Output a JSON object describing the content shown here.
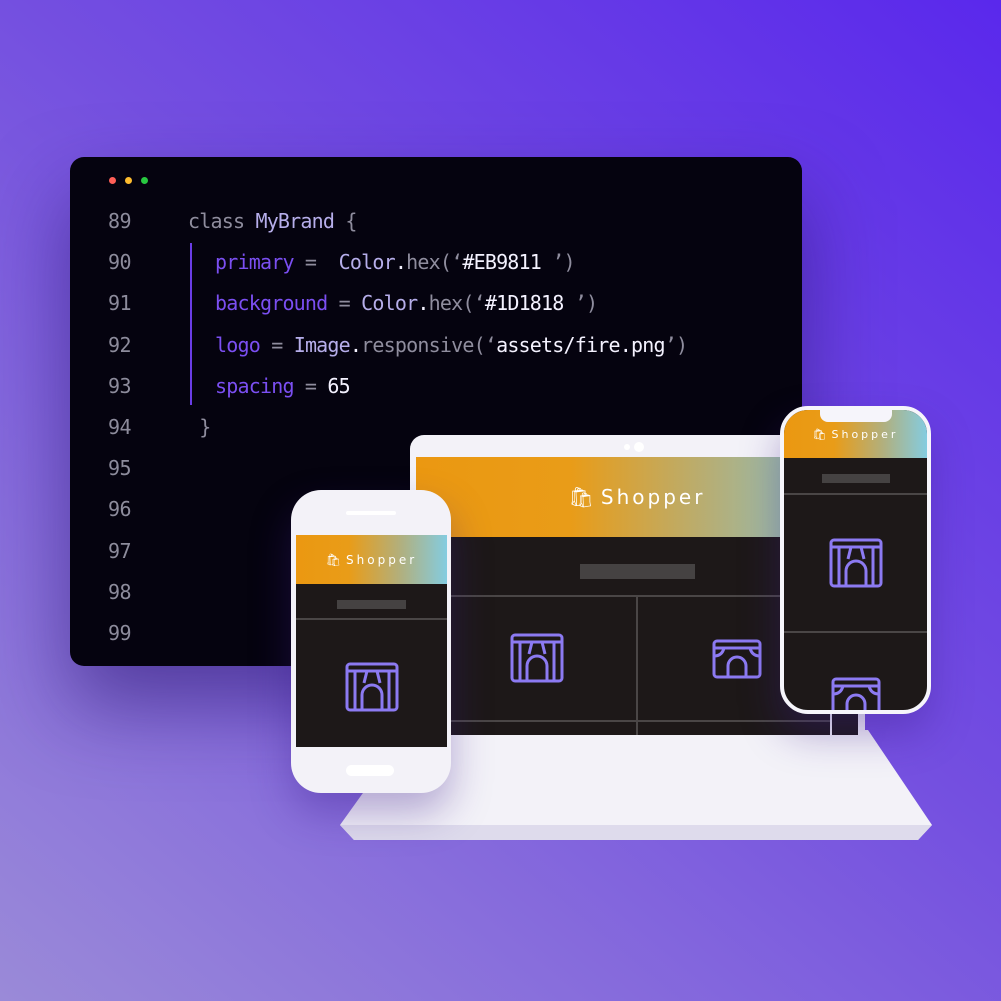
{
  "code_editor": {
    "window_dots": [
      "#ff5f57",
      "#febc2e",
      "#28c840"
    ],
    "line_numbers": [
      "89",
      "90",
      "91",
      "92",
      "93",
      "94",
      "95",
      "96",
      "97",
      "98",
      "99"
    ],
    "lines": [
      {
        "indent": 0,
        "tokens": [
          {
            "t": "class ",
            "c": "gr"
          },
          {
            "t": "MyBrand",
            "c": "lv"
          },
          {
            "t": " {",
            "c": "gr"
          }
        ]
      },
      {
        "indent": 1,
        "tokens": [
          {
            "t": "primary",
            "c": "kw"
          },
          {
            "t": " =  ",
            "c": "gr"
          },
          {
            "t": "Color",
            "c": "lv"
          },
          {
            "t": ".",
            "c": "wh"
          },
          {
            "t": "hex(‘",
            "c": "gr"
          },
          {
            "t": "#EB9811",
            "c": "wh"
          },
          {
            "t": " ’)",
            "c": "gr"
          }
        ]
      },
      {
        "indent": 1,
        "tokens": [
          {
            "t": "background",
            "c": "kw"
          },
          {
            "t": " = ",
            "c": "gr"
          },
          {
            "t": "Color",
            "c": "lv"
          },
          {
            "t": ".",
            "c": "wh"
          },
          {
            "t": "hex(‘",
            "c": "gr"
          },
          {
            "t": "#1D1818",
            "c": "wh"
          },
          {
            "t": " ’)",
            "c": "gr"
          }
        ]
      },
      {
        "indent": 1,
        "tokens": [
          {
            "t": "logo",
            "c": "kw"
          },
          {
            "t": " = ",
            "c": "gr"
          },
          {
            "t": "Image",
            "c": "lv"
          },
          {
            "t": ".",
            "c": "wh"
          },
          {
            "t": "responsive(‘",
            "c": "gr"
          },
          {
            "t": "assets/fire.png",
            "c": "wh"
          },
          {
            "t": "’)",
            "c": "gr"
          }
        ]
      },
      {
        "indent": 1,
        "tokens": [
          {
            "t": "spacing",
            "c": "kw"
          },
          {
            "t": " = ",
            "c": "gr"
          },
          {
            "t": "65",
            "c": "wh"
          }
        ]
      },
      {
        "indent": 0,
        "tokens": [
          {
            "t": " }",
            "c": "gr"
          }
        ]
      }
    ]
  },
  "brand": {
    "name": "Shopper",
    "primary": "#EB9811",
    "background": "#1D1818",
    "accent": "#8c7af2"
  },
  "icons": [
    "shopping-bag-fire-icon",
    "pants-icon",
    "shorts-icon"
  ]
}
